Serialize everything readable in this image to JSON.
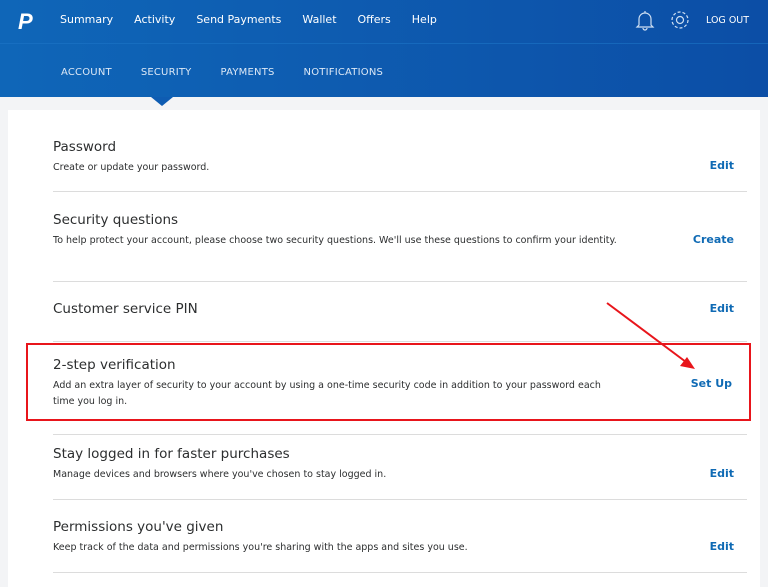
{
  "header": {
    "logo": "P",
    "nav": [
      "Summary",
      "Activity",
      "Send Payments",
      "Wallet",
      "Offers",
      "Help"
    ],
    "logout": "LOG OUT",
    "icons": [
      "bell-icon",
      "gear-icon"
    ]
  },
  "subnav": {
    "items": [
      "ACCOUNT",
      "SECURITY",
      "PAYMENTS",
      "NOTIFICATIONS"
    ],
    "active": "SECURITY"
  },
  "settings": [
    {
      "title": "Password",
      "desc": "Create or update your password.",
      "action": "Edit"
    },
    {
      "title": "Security questions",
      "desc": "To help protect your account, please choose two security questions. We'll use these questions to confirm your identity.",
      "action": "Create"
    },
    {
      "title": "Customer service PIN",
      "desc": "",
      "action": "Edit"
    },
    {
      "title": "2-step verification",
      "desc": "Add an extra layer of security to your account by using a one-time security code in addition to your password each time you log in.",
      "action": "Set Up",
      "highlighted": true
    },
    {
      "title": "Stay logged in for faster purchases",
      "desc": "Manage devices and browsers where you've chosen to stay logged in.",
      "action": "Edit"
    },
    {
      "title": "Permissions you've given",
      "desc": "Keep track of the data and permissions you're sharing with the apps and sites you use.",
      "action": "Edit"
    }
  ],
  "colors": {
    "brand": "#0c5cb0",
    "link": "#0f6ab4",
    "annotation": "#e8151b"
  }
}
